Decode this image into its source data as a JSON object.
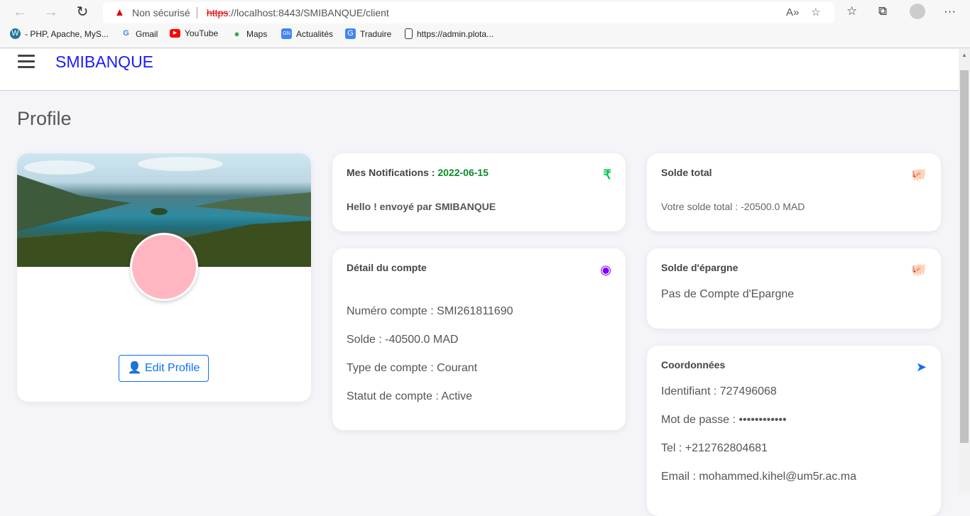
{
  "browser": {
    "security": "Non sécurisé",
    "url_scheme": "https",
    "url_rest": "://localhost:8443/SMIBANQUE/client",
    "bookmarks": [
      "- PHP, Apache, MyS...",
      "Gmail",
      "YouTube",
      "Maps",
      "Actualités",
      "Traduire",
      "https://admin.plota..."
    ]
  },
  "app": {
    "brand": "SMIBANQUE",
    "page_title": "Profile"
  },
  "profile": {
    "edit_label": "Edit Profile"
  },
  "notifications": {
    "title": "Mes Notifications : ",
    "date": "2022-06-15",
    "message": "Hello ! envoyé par SMIBANQUE",
    "icon": "rupee-icon",
    "icon_color": "#00c853"
  },
  "account": {
    "title": "Détail du compte",
    "icon_color": "#8000ff",
    "numero": "Numéro compte : SMI261811690",
    "solde": "Solde : -40500.0 MAD",
    "type": "Type de compte : Courant",
    "statut": "Statut de compte : Active"
  },
  "solde_total": {
    "title": "Solde total",
    "text": "Votre solde total : -20500.0 MAD",
    "icon_color": "#ff4fd8"
  },
  "epargne": {
    "title": "Solde d'épargne",
    "text": "Pas de Compte d'Epargne"
  },
  "coords": {
    "title": "Coordonnées",
    "icon_color": "#0d6efd",
    "identifiant": "Identifiant : 727496068",
    "password": "Mot de passe : ••••••••••••",
    "tel": "Tel : +212762804681",
    "email": "Email : mohammed.kihel@um5r.ac.ma"
  }
}
